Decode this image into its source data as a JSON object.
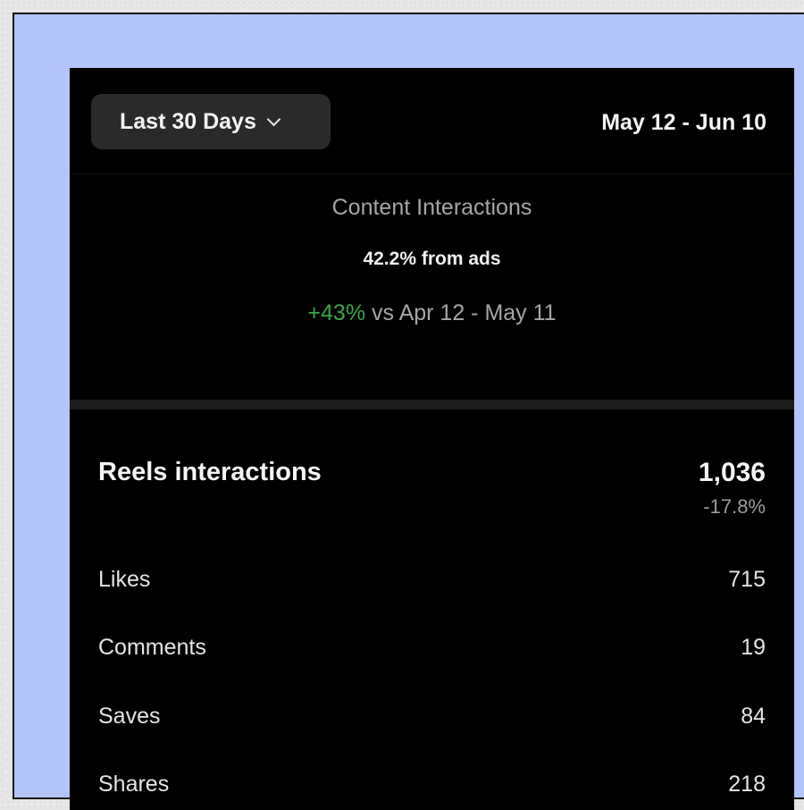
{
  "header": {
    "range_label": "Last 30 Days",
    "date_range": "May 12 - Jun 10"
  },
  "summary": {
    "title": "Content Interactions",
    "ads_note": "42.2% from ads",
    "change": "+43%",
    "comparison": " vs Apr 12 - May 11"
  },
  "reels": {
    "title": "Reels interactions",
    "total": "1,036",
    "change": "-17.8%",
    "rows": [
      {
        "label": "Likes",
        "value": "715"
      },
      {
        "label": "Comments",
        "value": "19"
      },
      {
        "label": "Saves",
        "value": "84"
      },
      {
        "label": "Shares",
        "value": "218"
      }
    ]
  },
  "colors": {
    "background_frame": "#b3c4fb",
    "panel": "#000000",
    "positive": "#3ca546",
    "muted_text": "#a6a6a6"
  },
  "icons": {
    "range_dropdown": "chevron-down-icon"
  }
}
